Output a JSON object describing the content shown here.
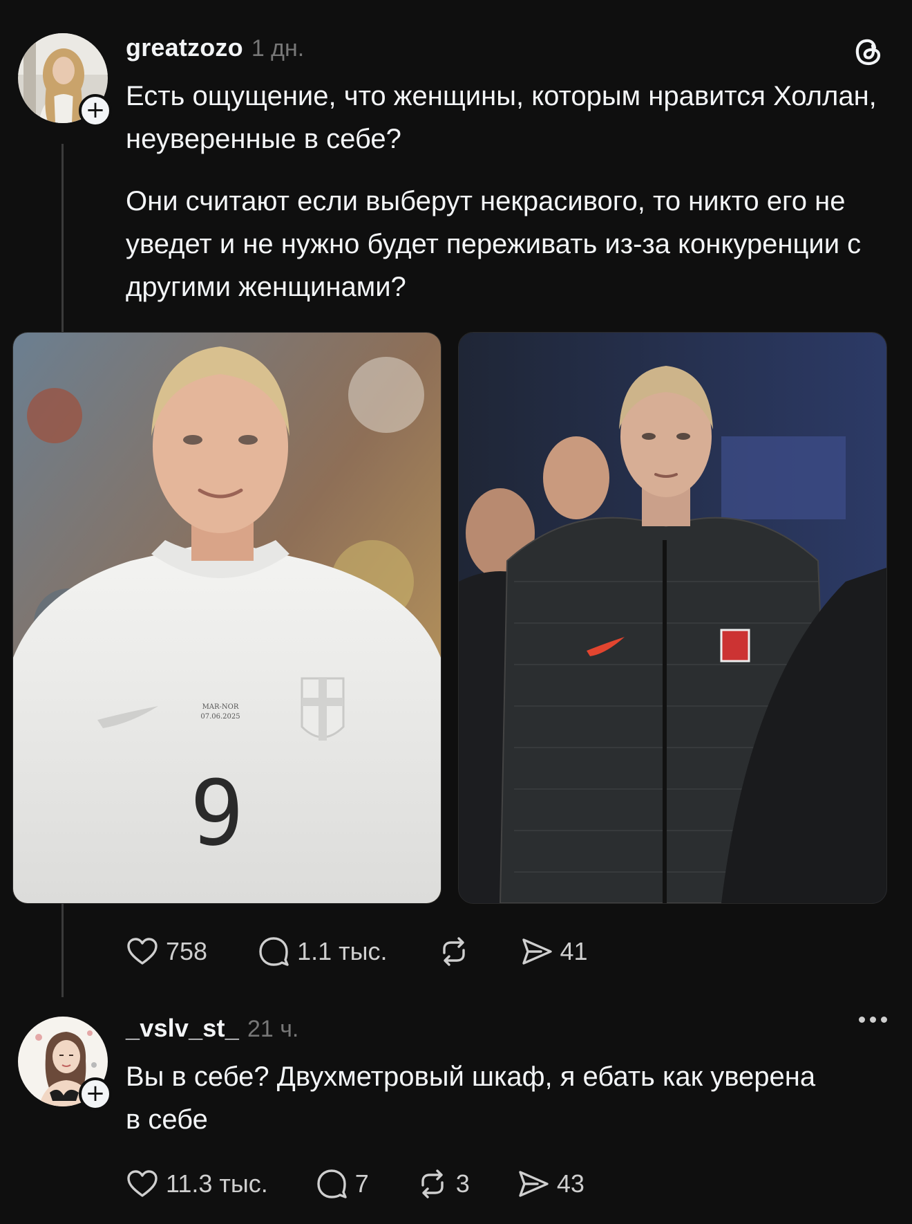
{
  "post1": {
    "username": "greatzozo",
    "time": "1 дн.",
    "paragraphs": [
      "Есть ощущение, что женщины, которым нравится Холлан, неуверенные в себе?",
      "Они считают если выберут некрасивого, то никто его не уведет и не нужно будет переживать из-за конкуренции с другими женщинами?"
    ],
    "jersey_text": "MAR-NOR\n07.06.2025",
    "jersey_number": "9",
    "actions": {
      "likes": "758",
      "replies": "1.1 тыс.",
      "reposts": "",
      "shares": "41"
    }
  },
  "post2": {
    "username": "_vslv_st_",
    "time": "21 ч.",
    "text": "Вы в себе? Двухметровый шкаф, я ебать как уверена в себе",
    "actions": {
      "likes": "11.3 тыс.",
      "replies": "7",
      "reposts": "3",
      "shares": "43"
    }
  },
  "icons": {
    "app_logo": "threads-logo-icon",
    "like": "heart-icon",
    "reply": "comment-icon",
    "repost": "repost-icon",
    "share": "send-icon",
    "more": "more-dots-icon",
    "follow": "plus-icon"
  },
  "colors": {
    "background": "#0f0f0f",
    "text": "#f3f5f7",
    "muted": "#777777",
    "thread_line": "#3b3b3b"
  }
}
